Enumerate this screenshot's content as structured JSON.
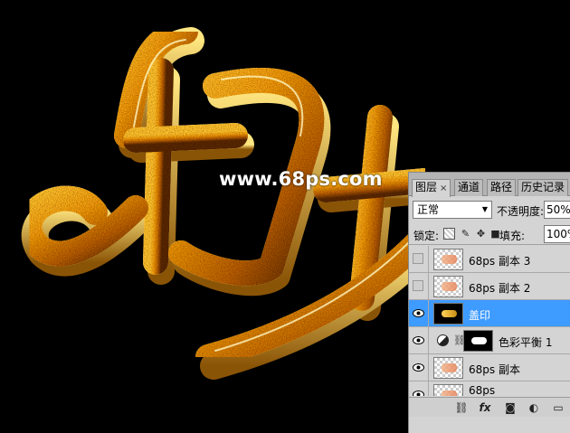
{
  "canvas": {
    "watermark": "www.68ps.com"
  },
  "panel": {
    "tabs": [
      {
        "label": "图层",
        "close": "×",
        "active": true
      },
      {
        "label": "通道",
        "active": false
      },
      {
        "label": "路径",
        "active": false
      },
      {
        "label": "历史记录",
        "active": false
      }
    ],
    "blend_mode": "正常",
    "opacity_label": "不透明度:",
    "opacity_value": "50%",
    "lock_label": "锁定:",
    "fill_label": "填充:",
    "fill_value": "100%",
    "layers": [
      {
        "name": "68ps 副本 3",
        "visible": false,
        "selected": false
      },
      {
        "name": "68ps 副本 2",
        "visible": false,
        "selected": false
      },
      {
        "name": "盖印",
        "visible": true,
        "selected": true
      },
      {
        "name": "色彩平衡 1",
        "visible": true,
        "selected": false
      },
      {
        "name": "68ps 副本",
        "visible": true,
        "selected": false
      },
      {
        "name": "68ps",
        "visible": true,
        "selected": false
      }
    ],
    "footer_icons": [
      "link-icon",
      "fx-icon",
      "mask-icon",
      "adjustment-icon",
      "folder-icon"
    ]
  },
  "colors": {
    "selection": "#3e9bff",
    "gold_light": "#ffe27a",
    "gold_mid": "#e0a420",
    "gold_dark": "#7a4a05"
  }
}
